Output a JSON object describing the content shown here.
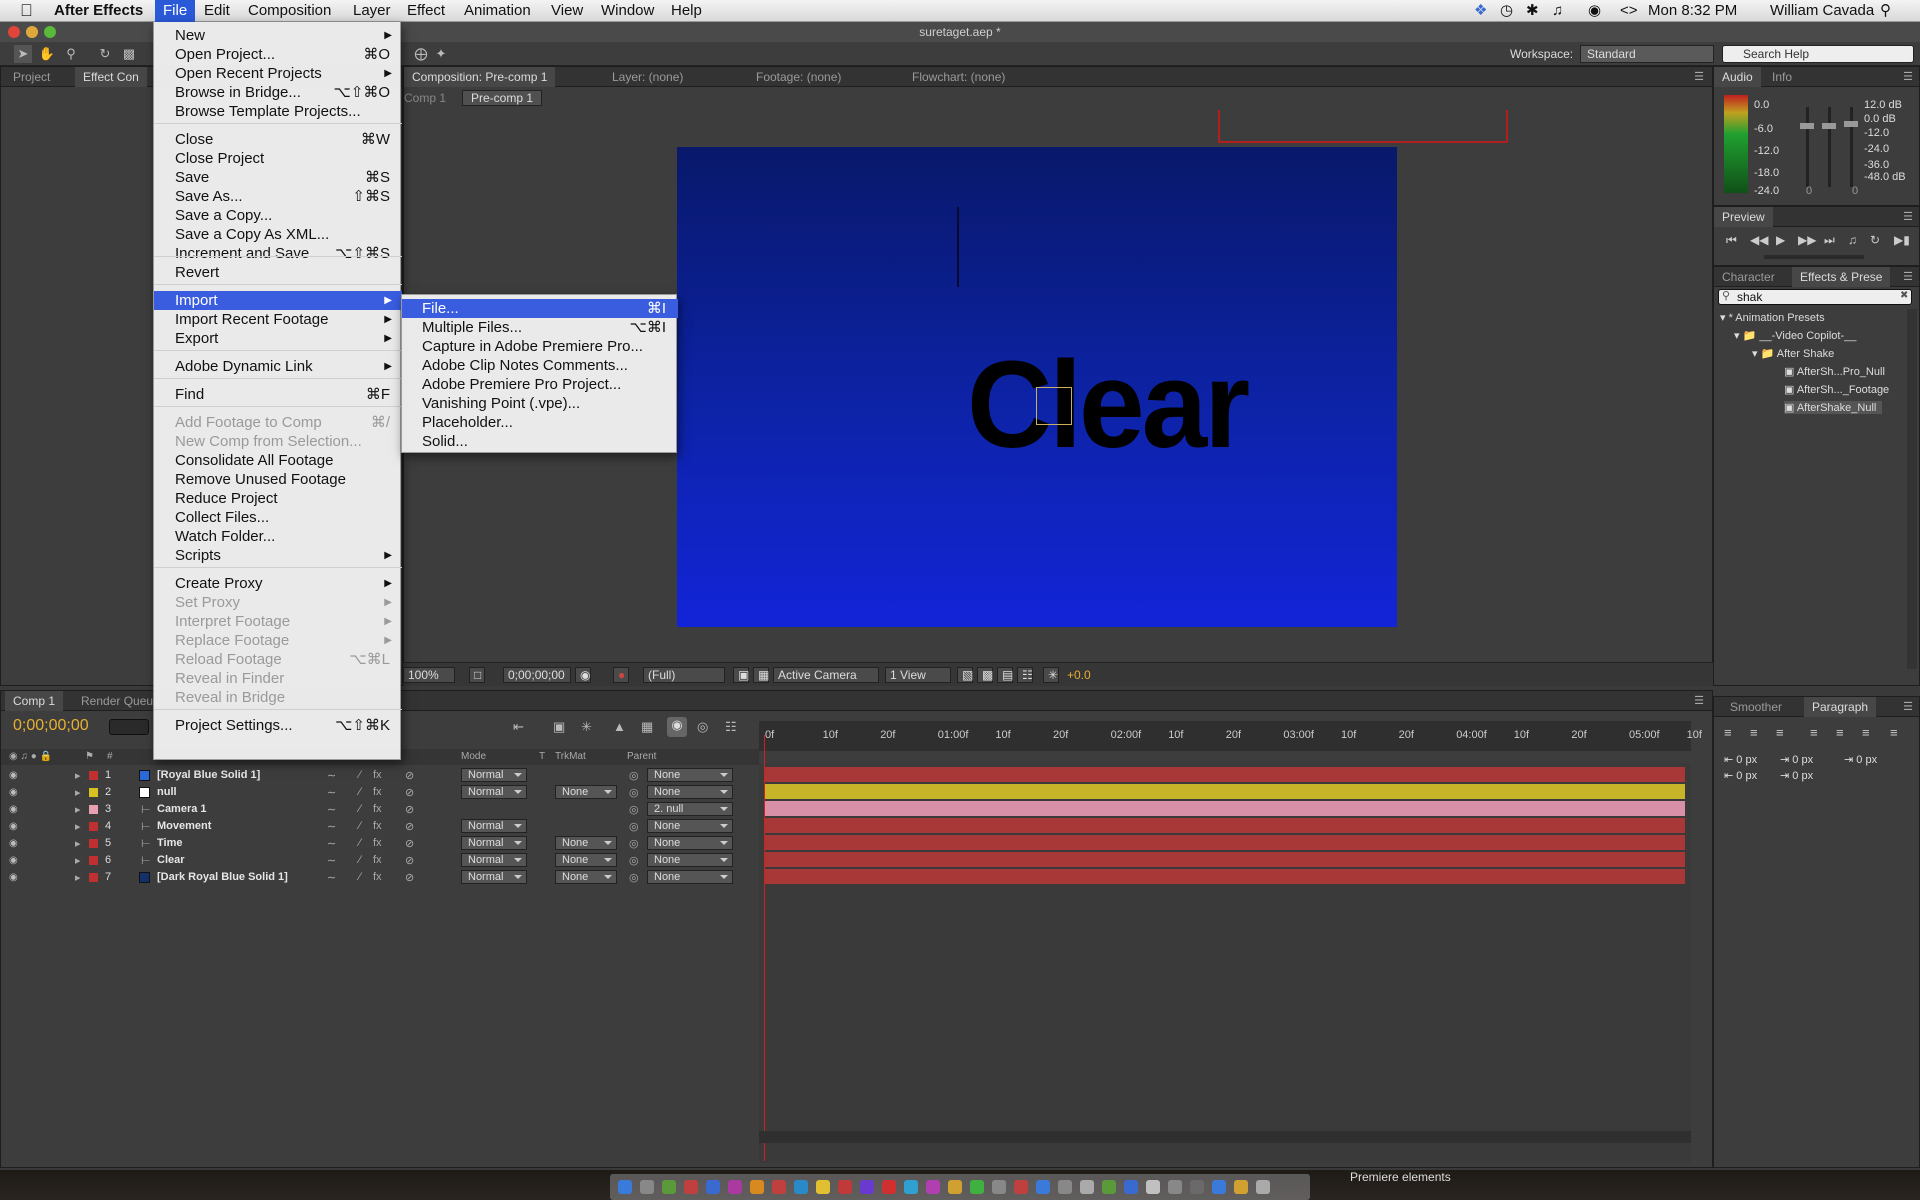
{
  "menubar": {
    "app_name": "After Effects",
    "items": [
      "File",
      "Edit",
      "Composition",
      "Layer",
      "Effect",
      "Animation",
      "View",
      "Window",
      "Help"
    ],
    "clock": "Mon 8:32 PM",
    "user": "William Cavada"
  },
  "window": {
    "title": "suretaget.aep *"
  },
  "toolbar": {
    "workspace_label": "Workspace:",
    "workspace_value": "Standard",
    "search_placeholder": "Search Help"
  },
  "left_panel": {
    "tabs": [
      "Project",
      "Effect Con"
    ]
  },
  "comp_panel": {
    "tabs": [
      "Composition: Pre-comp 1",
      "Layer: (none)",
      "Footage: (none)",
      "Flowchart: (none)"
    ],
    "breadcrumbs": [
      "Comp 1",
      "Pre-comp 1"
    ],
    "comp_text": "Clear",
    "bottom_bar": {
      "zoom": "100%",
      "timecode": "0;00;00;00",
      "resolution": "(Full)",
      "camera": "Active Camera",
      "view": "1 View",
      "exposure": "+0.0"
    }
  },
  "file_menu": {
    "items": [
      {
        "label": "New",
        "shortcut": "",
        "submenu": true,
        "disabled": false
      },
      {
        "label": "Open Project...",
        "shortcut": "⌘O",
        "submenu": false,
        "disabled": false
      },
      {
        "label": "Open Recent Projects",
        "shortcut": "",
        "submenu": true,
        "disabled": false
      },
      {
        "label": "Browse in Bridge...",
        "shortcut": "⌥⇧⌘O",
        "submenu": false,
        "disabled": false
      },
      {
        "label": "Browse Template Projects...",
        "shortcut": "",
        "submenu": false,
        "disabled": false
      },
      {
        "label": "Close",
        "shortcut": "⌘W",
        "submenu": false,
        "disabled": false
      },
      {
        "label": "Close Project",
        "shortcut": "",
        "submenu": false,
        "disabled": false
      },
      {
        "label": "Save",
        "shortcut": "⌘S",
        "submenu": false,
        "disabled": false
      },
      {
        "label": "Save As...",
        "shortcut": "⇧⌘S",
        "submenu": false,
        "disabled": false
      },
      {
        "label": "Save a Copy...",
        "shortcut": "",
        "submenu": false,
        "disabled": false
      },
      {
        "label": "Save a Copy As XML...",
        "shortcut": "",
        "submenu": false,
        "disabled": false
      },
      {
        "label": "Increment and Save",
        "shortcut": "⌥⇧⌘S",
        "submenu": false,
        "disabled": false
      },
      {
        "label": "Revert",
        "shortcut": "",
        "submenu": false,
        "disabled": false
      },
      {
        "label": "Import",
        "shortcut": "",
        "submenu": true,
        "disabled": false
      },
      {
        "label": "Import Recent Footage",
        "shortcut": "",
        "submenu": true,
        "disabled": false
      },
      {
        "label": "Export",
        "shortcut": "",
        "submenu": true,
        "disabled": false
      },
      {
        "label": "Adobe Dynamic Link",
        "shortcut": "",
        "submenu": true,
        "disabled": false
      },
      {
        "label": "Find",
        "shortcut": "⌘F",
        "submenu": false,
        "disabled": false
      },
      {
        "label": "Add Footage to Comp",
        "shortcut": "⌘/",
        "submenu": false,
        "disabled": true
      },
      {
        "label": "New Comp from Selection...",
        "shortcut": "",
        "submenu": false,
        "disabled": true
      },
      {
        "label": "Consolidate All Footage",
        "shortcut": "",
        "submenu": false,
        "disabled": false
      },
      {
        "label": "Remove Unused Footage",
        "shortcut": "",
        "submenu": false,
        "disabled": false
      },
      {
        "label": "Reduce Project",
        "shortcut": "",
        "submenu": false,
        "disabled": false
      },
      {
        "label": "Collect Files...",
        "shortcut": "",
        "submenu": false,
        "disabled": false
      },
      {
        "label": "Watch Folder...",
        "shortcut": "",
        "submenu": false,
        "disabled": false
      },
      {
        "label": "Scripts",
        "shortcut": "",
        "submenu": true,
        "disabled": false
      },
      {
        "label": "Create Proxy",
        "shortcut": "",
        "submenu": true,
        "disabled": false
      },
      {
        "label": "Set Proxy",
        "shortcut": "",
        "submenu": true,
        "disabled": true
      },
      {
        "label": "Interpret Footage",
        "shortcut": "",
        "submenu": true,
        "disabled": true
      },
      {
        "label": "Replace Footage",
        "shortcut": "",
        "submenu": true,
        "disabled": true
      },
      {
        "label": "Reload Footage",
        "shortcut": "⌥⌘L",
        "submenu": false,
        "disabled": true
      },
      {
        "label": "Reveal in Finder",
        "shortcut": "",
        "submenu": false,
        "disabled": true
      },
      {
        "label": "Reveal in Bridge",
        "shortcut": "",
        "submenu": false,
        "disabled": true
      },
      {
        "label": "Project Settings...",
        "shortcut": "⌥⇧⌘K",
        "submenu": false,
        "disabled": false
      }
    ]
  },
  "import_menu": {
    "items": [
      {
        "label": "File...",
        "shortcut": "⌘I"
      },
      {
        "label": "Multiple Files...",
        "shortcut": "⌥⌘I"
      },
      {
        "label": "Capture in Adobe Premiere Pro...",
        "shortcut": ""
      },
      {
        "label": "Adobe Clip Notes Comments...",
        "shortcut": ""
      },
      {
        "label": "Adobe Premiere Pro Project...",
        "shortcut": ""
      },
      {
        "label": "Vanishing Point (.vpe)...",
        "shortcut": ""
      },
      {
        "label": "Placeholder...",
        "shortcut": ""
      },
      {
        "label": "Solid...",
        "shortcut": ""
      }
    ]
  },
  "timeline": {
    "tabs": [
      "Comp 1",
      "Render Queue"
    ],
    "timecode": "0;00;00;00",
    "columns": {
      "mode": "Mode",
      "t": "T",
      "trkmat": "TrkMat",
      "parent": "Parent"
    },
    "ruler": [
      "0f",
      "10f",
      "20f",
      "01:00f",
      "10f",
      "20f",
      "02:00f",
      "10f",
      "20f",
      "03:00f",
      "10f",
      "20f",
      "04:00f",
      "10f",
      "20f",
      "05:00f",
      "10f"
    ],
    "layers": [
      {
        "num": "1",
        "name": "[Royal Blue Solid 1]",
        "label_color": "#c03030",
        "swatch": "#2a6ad8",
        "mode": "Normal",
        "trkmat": "",
        "parent": "None",
        "bar": "#a83838"
      },
      {
        "num": "2",
        "name": "null",
        "label_color": "#d8c020",
        "swatch": "#ffffff",
        "mode": "Normal",
        "trkmat": "None",
        "parent": "None",
        "bar": "#c8b428"
      },
      {
        "num": "3",
        "name": "Camera 1",
        "label_color": "#e8a0b0",
        "swatch": "",
        "mode": "",
        "trkmat": "",
        "parent": "2. null",
        "bar": "#d890a8"
      },
      {
        "num": "4",
        "name": "Movement",
        "label_color": "#c03030",
        "swatch": "",
        "mode": "Normal",
        "trkmat": "",
        "parent": "None",
        "bar": "#a83838"
      },
      {
        "num": "5",
        "name": "Time",
        "label_color": "#c03030",
        "swatch": "",
        "mode": "Normal",
        "trkmat": "None",
        "parent": "None",
        "bar": "#a83838"
      },
      {
        "num": "6",
        "name": "Clear",
        "label_color": "#c03030",
        "swatch": "",
        "mode": "Normal",
        "trkmat": "None",
        "parent": "None",
        "bar": "#a83838"
      },
      {
        "num": "7",
        "name": "[Dark Royal Blue Solid 1]",
        "label_color": "#c03030",
        "swatch": "#14306a",
        "mode": "Normal",
        "trkmat": "None",
        "parent": "None",
        "bar": "#a83838"
      }
    ]
  },
  "audio_panel": {
    "tabs": [
      "Audio",
      "Info"
    ],
    "left_scale": [
      "0.0",
      "-6.0",
      "-12.0",
      "-18.0",
      "-24.0"
    ],
    "right_scale": [
      "12.0 dB",
      "0.0 dB",
      "-12.0",
      "-24.0",
      "-36.0",
      "-48.0 dB"
    ],
    "fader_labels": [
      "0",
      "0"
    ]
  },
  "preview_panel": {
    "tab": "Preview"
  },
  "effects_panel": {
    "tabs": [
      "Character",
      "Effects & Prese"
    ],
    "search_value": "shak",
    "tree": [
      "* Animation Presets",
      "__-Video Copilot-__",
      "After Shake",
      "AfterSh...Pro_Null",
      "AfterSh..._Footage",
      "AfterShake_Null"
    ]
  },
  "paragraph_panel": {
    "tabs": [
      "Smoother",
      "Paragraph"
    ],
    "values": [
      "0 px",
      "0 px",
      "0 px",
      "0 px",
      "0 px"
    ]
  },
  "dock": {
    "tooltip": "Premiere elements"
  }
}
